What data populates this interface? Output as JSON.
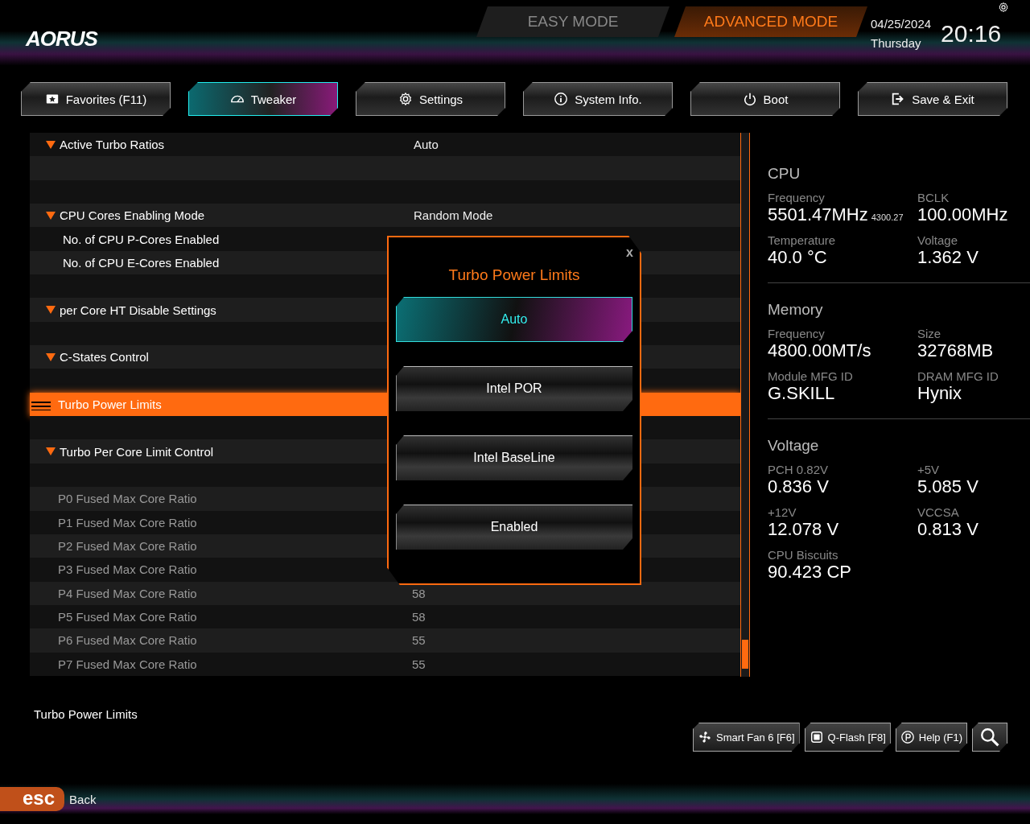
{
  "header": {
    "logo": "AORUS",
    "modes": [
      {
        "label": "EASY MODE",
        "selected": false
      },
      {
        "label": "ADVANCED MODE",
        "selected": true
      }
    ],
    "date": "04/25/2024",
    "weekday": "Thursday",
    "time": "20:16"
  },
  "tabs": [
    {
      "label": "Favorites (F11)",
      "selected": false
    },
    {
      "label": "Tweaker",
      "selected": true
    },
    {
      "label": "Settings",
      "selected": false
    },
    {
      "label": "System Info.",
      "selected": false
    },
    {
      "label": "Boot",
      "selected": false
    },
    {
      "label": "Save & Exit",
      "selected": false
    }
  ],
  "rows": [
    {
      "kind": "section",
      "label": "Active Turbo Ratios",
      "value": "Auto",
      "selected": false,
      "disabled": false
    },
    {
      "kind": "blank"
    },
    {
      "kind": "blank"
    },
    {
      "kind": "section",
      "label": "CPU Cores Enabling Mode",
      "value": "Random Mode",
      "selected": false,
      "disabled": false
    },
    {
      "kind": "sub",
      "label": "No. of CPU P-Cores Enabled",
      "selected": false,
      "disabled": false
    },
    {
      "kind": "sub",
      "label": "No. of CPU E-Cores Enabled",
      "selected": false,
      "disabled": false
    },
    {
      "kind": "blank"
    },
    {
      "kind": "section",
      "label": "per Core HT Disable Settings",
      "selected": false,
      "disabled": false
    },
    {
      "kind": "blank"
    },
    {
      "kind": "section",
      "label": "C-States Control",
      "selected": false,
      "disabled": false
    },
    {
      "kind": "blank"
    },
    {
      "kind": "item",
      "label": "Turbo Power Limits",
      "selected": true,
      "disabled": false
    },
    {
      "kind": "blank"
    },
    {
      "kind": "section",
      "label": "Turbo Per Core Limit Control",
      "selected": false,
      "disabled": false
    },
    {
      "kind": "blank"
    },
    {
      "kind": "item",
      "label": "P0 Fused Max Core Ratio",
      "selected": false,
      "disabled": true
    },
    {
      "kind": "item",
      "label": "P1 Fused Max Core Ratio",
      "selected": false,
      "disabled": true
    },
    {
      "kind": "item",
      "label": "P2 Fused Max Core Ratio",
      "selected": false,
      "disabled": true
    },
    {
      "kind": "item",
      "label": "P3 Fused Max Core Ratio",
      "selected": false,
      "disabled": true
    },
    {
      "kind": "item",
      "label": "P4 Fused Max Core Ratio",
      "value": "58",
      "selected": false,
      "disabled": true
    },
    {
      "kind": "item",
      "label": "P5 Fused Max Core Ratio",
      "value": "58",
      "selected": false,
      "disabled": true
    },
    {
      "kind": "item",
      "label": "P6 Fused Max Core Ratio",
      "value": "55",
      "selected": false,
      "disabled": true
    },
    {
      "kind": "item",
      "label": "P7 Fused Max Core Ratio",
      "value": "55",
      "selected": false,
      "disabled": true
    }
  ],
  "popup": {
    "title": "Turbo Power Limits",
    "close": "x",
    "options": [
      {
        "label": "Auto",
        "selected": true
      },
      {
        "label": "Intel POR",
        "selected": false
      },
      {
        "label": "Intel BaseLine",
        "selected": false
      },
      {
        "label": "Enabled",
        "selected": false
      }
    ]
  },
  "monitor": [
    {
      "title": "CPU",
      "fields": [
        {
          "label": "Frequency",
          "value": "5501.47MHz",
          "secondary": "4300.27"
        },
        {
          "label": "BCLK",
          "value": "100.00MHz"
        },
        {
          "label": "Temperature",
          "value": "40.0 °C"
        },
        {
          "label": "Voltage",
          "value": "1.362 V"
        }
      ]
    },
    {
      "title": "Memory",
      "fields": [
        {
          "label": "Frequency",
          "value": "4800.00MT/s"
        },
        {
          "label": "Size",
          "value": "32768MB"
        },
        {
          "label": "Module MFG ID",
          "value": "G.SKILL"
        },
        {
          "label": "DRAM MFG ID",
          "value": "Hynix"
        }
      ]
    },
    {
      "title": "Voltage",
      "fields": [
        {
          "label": "PCH 0.82V",
          "value": "0.836 V"
        },
        {
          "label": "+5V",
          "value": "5.085 V"
        },
        {
          "label": "+12V",
          "value": "12.078 V"
        },
        {
          "label": "VCCSA",
          "value": "0.813 V"
        },
        {
          "label": "CPU Biscuits",
          "value": "90.423 CP"
        }
      ]
    }
  ],
  "description": "Turbo Power Limits",
  "tools": [
    {
      "kind": "labeled",
      "label": "Smart Fan 6 [F6]"
    },
    {
      "kind": "labeled",
      "label": "Q-Flash [F8]"
    },
    {
      "kind": "labeled",
      "label": "Help (F1)"
    },
    {
      "kind": "search"
    }
  ],
  "footer": {
    "key": "esc",
    "label": "Back"
  }
}
